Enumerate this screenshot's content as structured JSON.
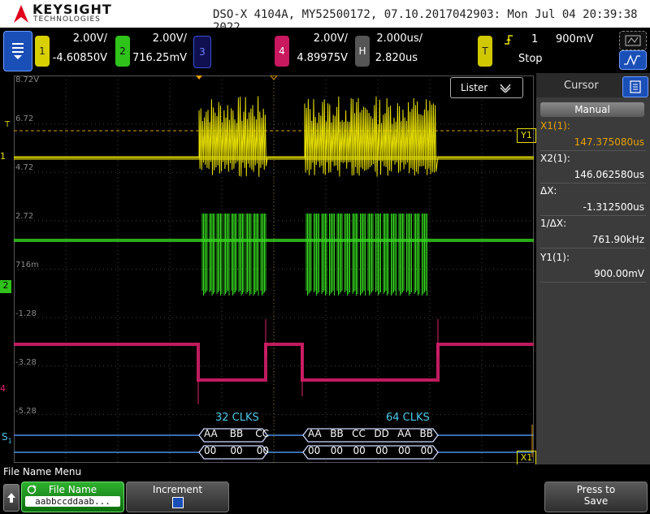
{
  "header": {
    "brand": "KEYSIGHT",
    "brand_sub": "TECHNOLOGIES",
    "info": "DSO-X 4104A, MY52500172, 07.10.2017042903: Mon Jul 04 20:39:38 2022"
  },
  "channels": {
    "ch1": {
      "num": "1",
      "scale": "2.00V/",
      "offset": "-4.60850V",
      "color": "#e8e000"
    },
    "ch2": {
      "num": "2",
      "scale": "2.00V/",
      "offset": "716.25mV",
      "color": "#35d61f"
    },
    "ch3": {
      "num": "3",
      "color": "#3b4fd6"
    },
    "ch4": {
      "num": "4",
      "scale": "2.00V/",
      "offset": "4.89975V",
      "color": "#e0206e"
    },
    "horiz": {
      "label": "H",
      "scale": "2.000us/",
      "delay": "2.820us"
    },
    "trigger": {
      "label": "T",
      "source": "1",
      "level": "900mV",
      "state": "Stop"
    }
  },
  "levels": {
    "ch1": [
      "8.72V",
      "6.72",
      "4.72",
      "2.72"
    ],
    "ch2": [
      "716m"
    ],
    "ch4": [
      "-1.28",
      "-3.28",
      "-5.28"
    ]
  },
  "markers": {
    "y1": "Y1",
    "x1": "X1",
    "s1": "S",
    "s1_sub": "1",
    "trig_t": "T",
    "ch1_gnd": "1",
    "ch2_gnd": "2",
    "ch4_gnd": "4"
  },
  "decode": {
    "frame1_title": "32 CLKS",
    "frame2_title": "64 CLKS",
    "frame1_top": [
      "AA",
      "BB",
      "CC"
    ],
    "frame1_bot": [
      "00",
      "00",
      "00"
    ],
    "frame2_top": [
      "AA",
      "BB",
      "CC",
      "DD",
      "AA",
      "BB"
    ],
    "frame2_bot": [
      "00",
      "00",
      "00",
      "00",
      "00",
      "00"
    ]
  },
  "lister": {
    "label": "Lister"
  },
  "cursor_panel": {
    "title": "Cursor",
    "mode": "Manual",
    "x1_label": "X1(1):",
    "x1_value": "147.375080us",
    "x2_label": "X2(1):",
    "x2_value": "146.062580us",
    "dx_label": "ΔX:",
    "dx_value": "-1.312500us",
    "inv_dx_label": "1/ΔX:",
    "inv_dx_value": "761.90kHz",
    "y1_label": "Y1(1):",
    "y1_value": "900.00mV",
    "accent": "#e8a000"
  },
  "menu": {
    "title": "File Name Menu",
    "file_name_label": "File Name",
    "file_name_value": "aabbccddaab...",
    "increment_label": "Increment",
    "press_to_save": "Press to",
    "press_to_save2": "Save"
  }
}
